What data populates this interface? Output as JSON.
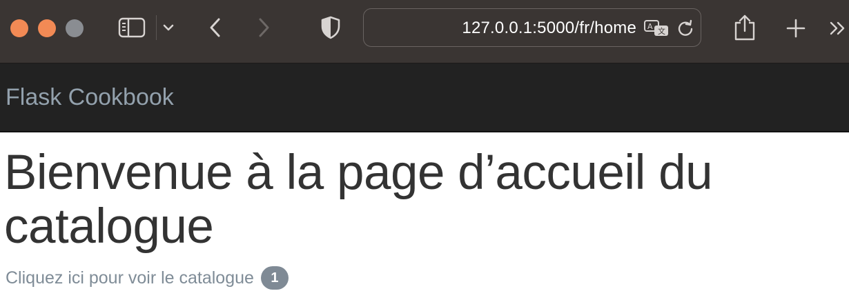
{
  "browser": {
    "url": "127.0.0.1:5000/fr/home",
    "icons": {
      "window_close": "close-dot-icon",
      "window_minimize": "minimize-dot-icon",
      "window_zoom": "zoom-dot-icon",
      "sidebar": "sidebar-icon",
      "sidebar_menu": "chevron-down-icon",
      "back": "chevron-left-icon",
      "forward": "chevron-right-icon",
      "privacy": "shield-icon",
      "translate": "translate-icon",
      "reload": "reload-icon",
      "share": "share-icon",
      "new_tab": "plus-icon",
      "more": "double-chevron-right-icon"
    },
    "colors": {
      "toolbar_bg": "#3a3533",
      "traffic_close": "#f28a55",
      "traffic_minimize": "#f28a55",
      "traffic_zoom": "#8a8d92"
    }
  },
  "navbar": {
    "brand": "Flask Cookbook",
    "colors": {
      "bg": "#222222",
      "brand": "#93a1ad"
    }
  },
  "main": {
    "title": "Bienvenue à la page d’accueil du catalogue",
    "catalog_link": "Cliquez ici pour voir le catalogue",
    "badge_count": "1",
    "colors": {
      "title": "#333333",
      "link": "#7f8c97",
      "badge_bg": "#7f8a95"
    }
  }
}
